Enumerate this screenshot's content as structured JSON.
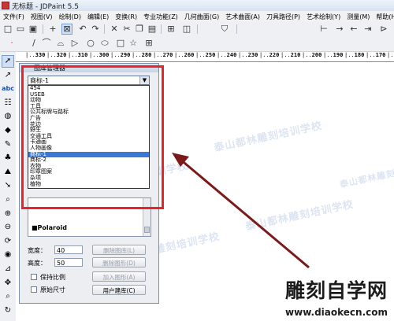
{
  "title_bar": {
    "title": "无标题 - JDPaint 5.5"
  },
  "menu": [
    "文件(F)",
    "视图(V)",
    "绘制(D)",
    "编辑(E)",
    "变换(R)",
    "专业功能(Z)",
    "几何曲面(G)",
    "艺术曲面(A)",
    "刀具路径(P)",
    "艺术绘制(Y)",
    "测量(M)",
    "帮助(H)"
  ],
  "toolbar1_icons": [
    {
      "name": "new-icon",
      "glyph": "□"
    },
    {
      "name": "open-icon",
      "glyph": "▭"
    },
    {
      "name": "save-icon",
      "glyph": "▣"
    },
    {
      "name": "select-icon",
      "glyph": "+"
    },
    {
      "name": "box-select-icon",
      "glyph": "⊠"
    },
    {
      "name": "undo-icon",
      "glyph": "↶"
    },
    {
      "name": "redo-icon",
      "glyph": "↷"
    },
    {
      "name": "delete-icon",
      "glyph": "✕"
    },
    {
      "name": "cut-icon",
      "glyph": "✂"
    },
    {
      "name": "copy-icon",
      "glyph": "❐"
    },
    {
      "name": "paste-icon",
      "glyph": "▤"
    },
    {
      "name": "grid-icon",
      "glyph": "⊞"
    },
    {
      "name": "layer-icon",
      "glyph": "◫"
    },
    {
      "name": "shield-icon",
      "glyph": "⛉"
    }
  ],
  "toolbar1_right_icons": [
    {
      "name": "move-icon",
      "glyph": "⊢"
    },
    {
      "name": "arrow-right-icon",
      "glyph": "→"
    },
    {
      "name": "arrow-left-icon",
      "glyph": "←"
    },
    {
      "name": "zoom-icon",
      "glyph": "⇥"
    },
    {
      "name": "fit-icon",
      "glyph": "⊳"
    }
  ],
  "toolbar2_icons": [
    {
      "name": "point-icon",
      "glyph": "·"
    },
    {
      "name": "line-icon",
      "glyph": "/"
    },
    {
      "name": "polyline-icon",
      "glyph": "⌒"
    },
    {
      "name": "arc-icon",
      "glyph": "⌓"
    },
    {
      "name": "bezier-icon",
      "glyph": "▷"
    },
    {
      "name": "circle-icon",
      "glyph": "○"
    },
    {
      "name": "ellipse-icon",
      "glyph": "⬭"
    },
    {
      "name": "rect-icon",
      "glyph": "□"
    },
    {
      "name": "star-icon",
      "glyph": "☆"
    },
    {
      "name": "grid-pattern-icon",
      "glyph": "⊞"
    }
  ],
  "left_tools": [
    {
      "name": "pointer-icon",
      "glyph": "➚"
    },
    {
      "name": "node-edit-icon",
      "glyph": "↗"
    },
    {
      "name": "text-icon",
      "glyph": "abc"
    },
    {
      "name": "layer-tool-icon",
      "glyph": "☷"
    },
    {
      "name": "sphere-icon",
      "glyph": "◍"
    },
    {
      "name": "fill-icon",
      "glyph": "◆"
    },
    {
      "name": "pen-icon",
      "glyph": "✎"
    },
    {
      "name": "tree-icon",
      "glyph": "♣"
    },
    {
      "name": "sculpt-icon",
      "glyph": "⛰"
    },
    {
      "name": "arrow-tool-icon",
      "glyph": "➘"
    },
    {
      "name": "magnifier-icon",
      "glyph": "⌕"
    },
    {
      "name": "zoom-in-icon",
      "glyph": "⊕"
    },
    {
      "name": "zoom-out-icon",
      "glyph": "⊖"
    },
    {
      "name": "rotate-icon",
      "glyph": "⟳"
    },
    {
      "name": "eye-icon",
      "glyph": "◉"
    },
    {
      "name": "measure-icon",
      "glyph": "⊿"
    },
    {
      "name": "pan-icon",
      "glyph": "✥"
    },
    {
      "name": "zoom-window-icon",
      "glyph": "⌕"
    },
    {
      "name": "refresh-icon",
      "glyph": "↻"
    }
  ],
  "ruler_ticks": [
    "330",
    "320",
    "310",
    "300",
    "290",
    "280",
    "270",
    "260",
    "250",
    "240",
    "230",
    "220",
    "210",
    "200",
    "190",
    "180",
    "170",
    "160"
  ],
  "panel": {
    "title": "图库管理器",
    "combo_value": "商标-1",
    "options": [
      "454",
      "USEB",
      "动物",
      "工具",
      "公共标牌与路标",
      "广告",
      "花边",
      "野生",
      "交通工具",
      "卡通画",
      "人物画像",
      "商标-1",
      "商标-2",
      "衣物",
      "印章图案",
      "杂项",
      "植物"
    ],
    "selected_index": 11,
    "preview_logo": "■Polaroid",
    "width_label": "宽度：",
    "width_value": "40",
    "height_label": "高度：",
    "height_value": "50",
    "keep_ratio_label": "保持比例",
    "original_size_label": "原始尺寸",
    "btn_delete_lib": "删除图库(L)",
    "btn_delete_shape": "删除图形(D)",
    "btn_add_shape": "加入图形(A)",
    "btn_user_lib": "用户建库(C)"
  },
  "watermarks": {
    "repeat": "泰山都林雕刻培训学校",
    "brand": "雕刻自学网",
    "url": "www.diaokecn.com"
  },
  "colors": {
    "highlight": "#e8232a",
    "selection": "#3a78d4",
    "arrow": "#7b1a1a"
  }
}
